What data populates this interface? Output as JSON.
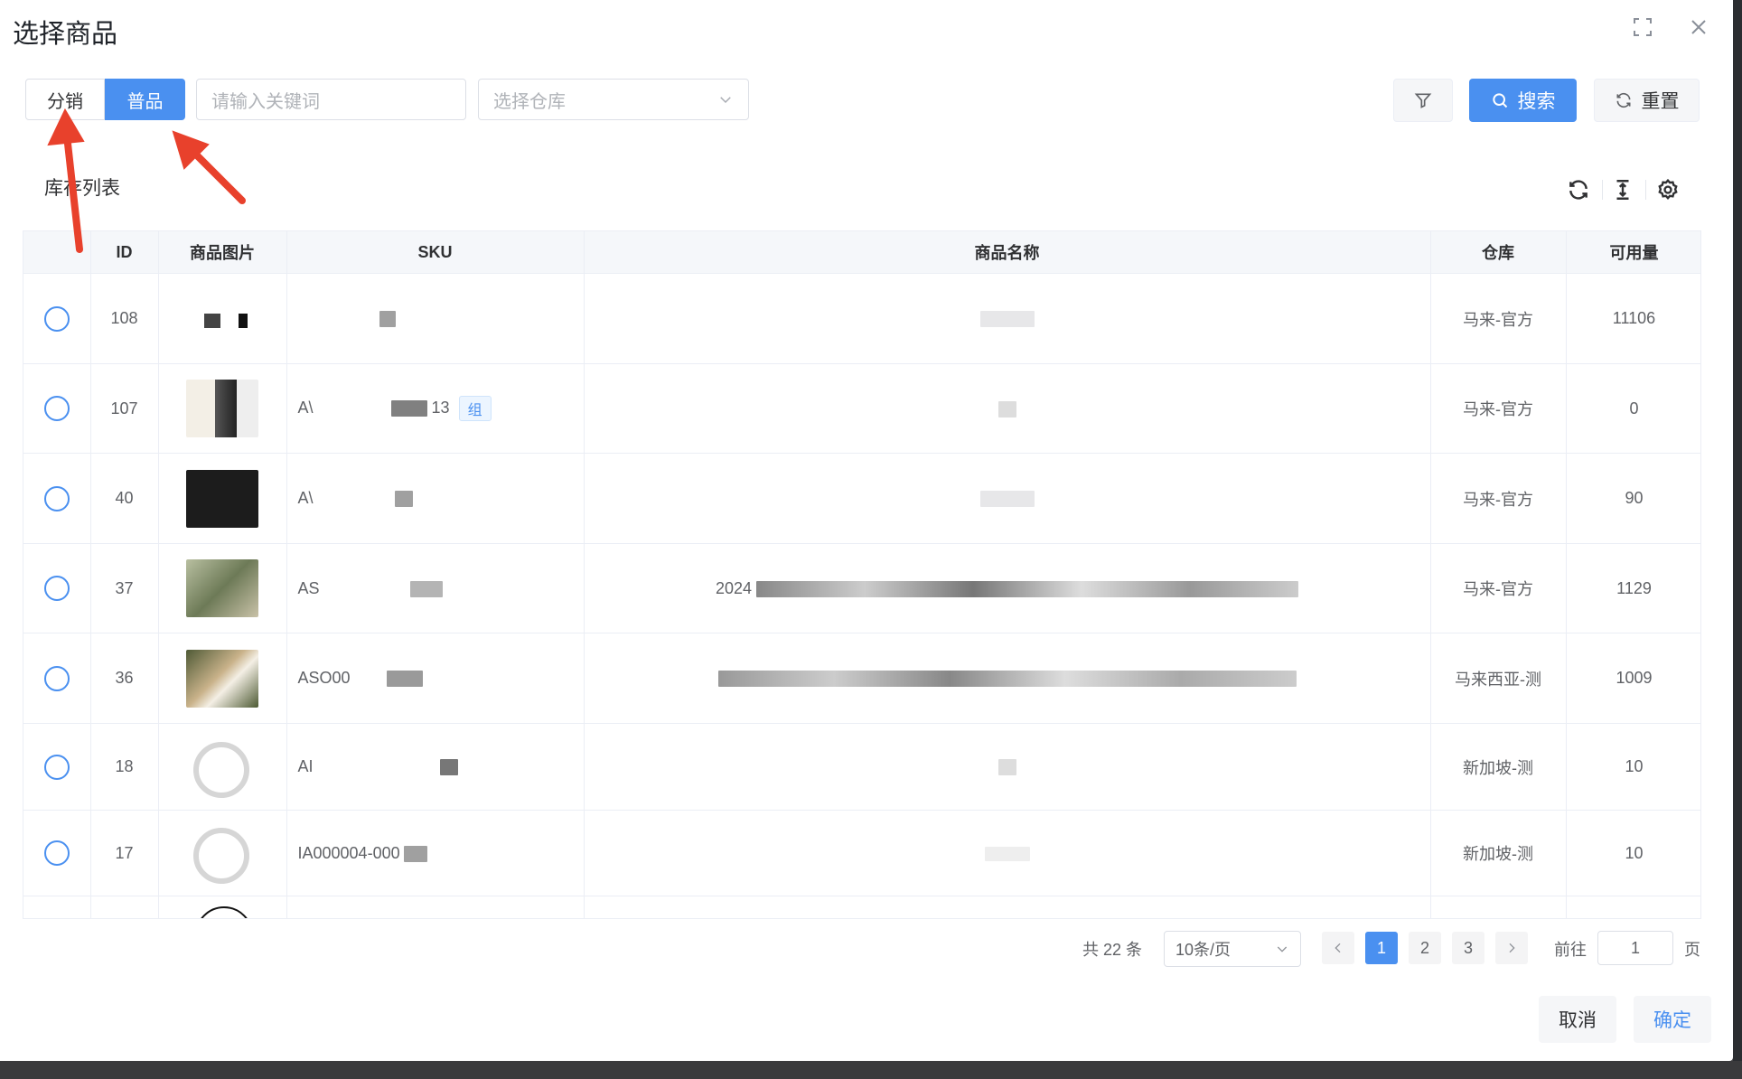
{
  "dialog": {
    "title": "选择商品"
  },
  "toolbar": {
    "tab_distribution": "分销",
    "tab_regular": "普品",
    "keyword_placeholder": "请输入关键词",
    "warehouse_placeholder": "选择仓库",
    "search_label": "搜索",
    "reset_label": "重置"
  },
  "list": {
    "title": "库存列表"
  },
  "table": {
    "columns": [
      "ID",
      "商品图片",
      "SKU",
      "商品名称",
      "仓库",
      "可用量"
    ],
    "rows": [
      {
        "id": "108",
        "sku": "",
        "name": "",
        "warehouse": "马来-官方",
        "qty": "11106"
      },
      {
        "id": "107",
        "sku": "A\\",
        "sku_tail": "13",
        "tag": "组",
        "name": "",
        "warehouse": "马来-官方",
        "qty": "0"
      },
      {
        "id": "40",
        "sku": "A\\",
        "name": "",
        "warehouse": "马来-官方",
        "qty": "90"
      },
      {
        "id": "37",
        "sku": "AS",
        "name": "2024",
        "warehouse": "马来-官方",
        "qty": "1129"
      },
      {
        "id": "36",
        "sku": "ASO00",
        "name": "",
        "warehouse": "马来西亚-测",
        "qty": "1009"
      },
      {
        "id": "18",
        "sku": "AI",
        "name": "",
        "warehouse": "新加坡-测",
        "qty": "10"
      },
      {
        "id": "17",
        "sku": "IA000004-000",
        "name": "",
        "warehouse": "新加坡-测",
        "qty": "10"
      }
    ]
  },
  "pagination": {
    "total": "共 22 条",
    "page_size": "10条/页",
    "pages": [
      "1",
      "2",
      "3"
    ],
    "current": "1",
    "goto_label": "前往",
    "goto_value": "1",
    "page_suffix": "页"
  },
  "footer": {
    "cancel": "取消",
    "confirm": "确定"
  },
  "colors": {
    "primary": "#4a90f0",
    "annotation_arrow": "#e8412c"
  }
}
